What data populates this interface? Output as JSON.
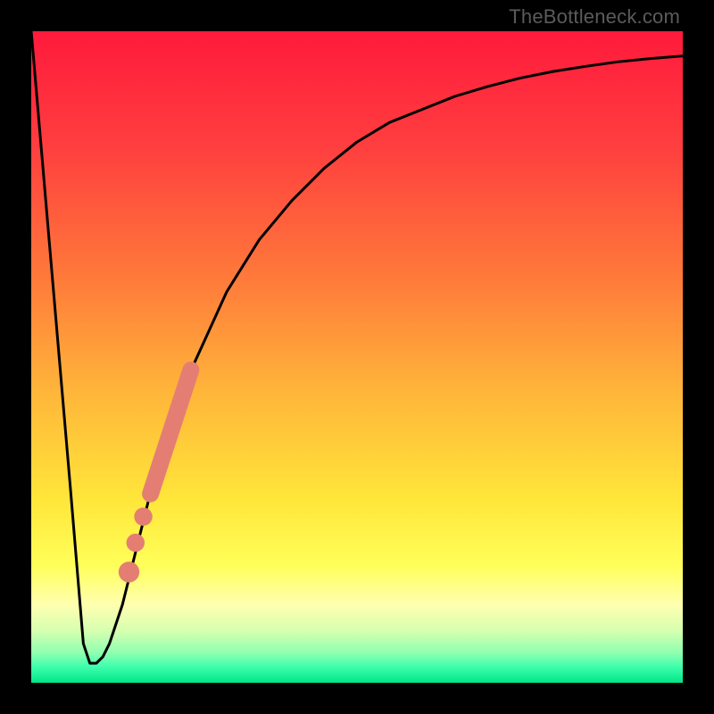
{
  "attribution": "TheBottleneck.com",
  "colors": {
    "frame": "#000000",
    "curve": "#000000",
    "markers": "#e47e72",
    "gradient_stops": [
      {
        "offset": 0.0,
        "color": "#ff1a3c"
      },
      {
        "offset": 0.18,
        "color": "#ff3f3f"
      },
      {
        "offset": 0.38,
        "color": "#ff7a3a"
      },
      {
        "offset": 0.55,
        "color": "#ffb43a"
      },
      {
        "offset": 0.72,
        "color": "#ffe63a"
      },
      {
        "offset": 0.82,
        "color": "#ffff5a"
      },
      {
        "offset": 0.88,
        "color": "#ffffb0"
      },
      {
        "offset": 0.92,
        "color": "#d7ffb0"
      },
      {
        "offset": 0.955,
        "color": "#8dffb0"
      },
      {
        "offset": 0.975,
        "color": "#3fffad"
      },
      {
        "offset": 1.0,
        "color": "#00e588"
      }
    ]
  },
  "chart_data": {
    "type": "line",
    "title": "",
    "xlabel": "",
    "ylabel": "",
    "xlim": [
      0,
      100
    ],
    "ylim": [
      0,
      100
    ],
    "grid": false,
    "legend": false,
    "series": [
      {
        "name": "bottleneck-curve",
        "x": [
          0,
          6,
          8,
          9,
          10,
          11,
          12,
          14,
          16,
          18,
          20,
          22,
          25,
          30,
          35,
          40,
          45,
          50,
          55,
          60,
          65,
          70,
          75,
          80,
          85,
          90,
          95,
          100
        ],
        "y": [
          100,
          30,
          6,
          3,
          3,
          4,
          6,
          12,
          20,
          28,
          35,
          41,
          49,
          60,
          68,
          74,
          79,
          83,
          86,
          88,
          90,
          91.5,
          92.8,
          93.8,
          94.6,
          95.3,
          95.8,
          96.2
        ]
      }
    ],
    "markers": [
      {
        "type": "segment",
        "x1": 18.3,
        "y1": 29,
        "x2": 24.5,
        "y2": 48,
        "width": 2.6
      },
      {
        "type": "dot",
        "x": 17.2,
        "y": 25.5,
        "r": 1.4
      },
      {
        "type": "dot",
        "x": 16.0,
        "y": 21.5,
        "r": 1.4
      },
      {
        "type": "dot",
        "x": 15.0,
        "y": 17.0,
        "r": 1.6
      }
    ]
  }
}
